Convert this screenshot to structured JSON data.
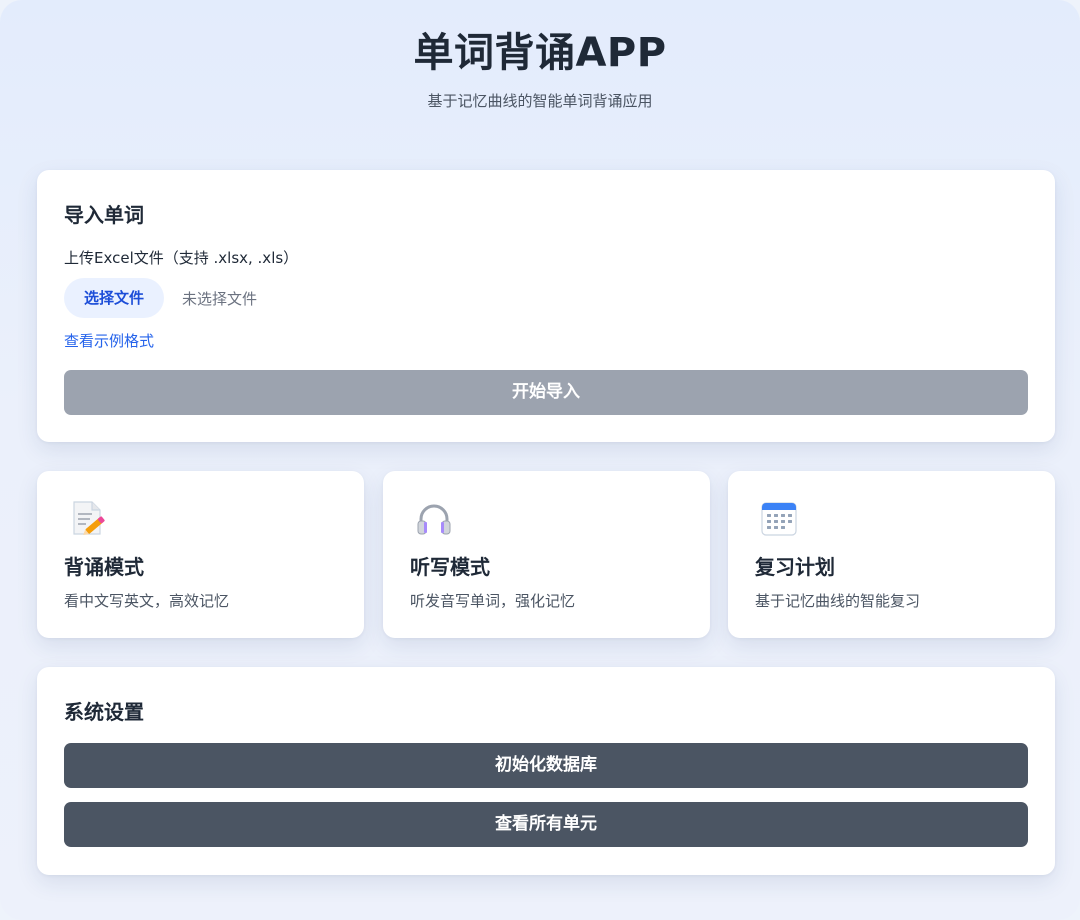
{
  "header": {
    "title": "单词背诵APP",
    "subtitle": "基于记忆曲线的智能单词背诵应用"
  },
  "import": {
    "heading": "导入单词",
    "upload_label": "上传Excel文件（支持 .xlsx, .xls）",
    "choose_button": "选择文件",
    "no_file_text": "未选择文件",
    "sample_link": "查看示例格式",
    "start_button": "开始导入"
  },
  "modes": [
    {
      "icon": "memo-pencil-icon",
      "title": "背诵模式",
      "desc": "看中文写英文，高效记忆"
    },
    {
      "icon": "headphones-icon",
      "title": "听写模式",
      "desc": "听发音写单词，强化记忆"
    },
    {
      "icon": "calendar-icon",
      "title": "复习计划",
      "desc": "基于记忆曲线的智能复习"
    }
  ],
  "settings": {
    "heading": "系统设置",
    "init_button": "初始化数据库",
    "units_button": "查看所有单元"
  },
  "colors": {
    "accent": "#2563eb",
    "disabled_button": "#9ca3af",
    "dark_button": "#4b5563",
    "choose_button_bg": "#eaf1ff"
  }
}
